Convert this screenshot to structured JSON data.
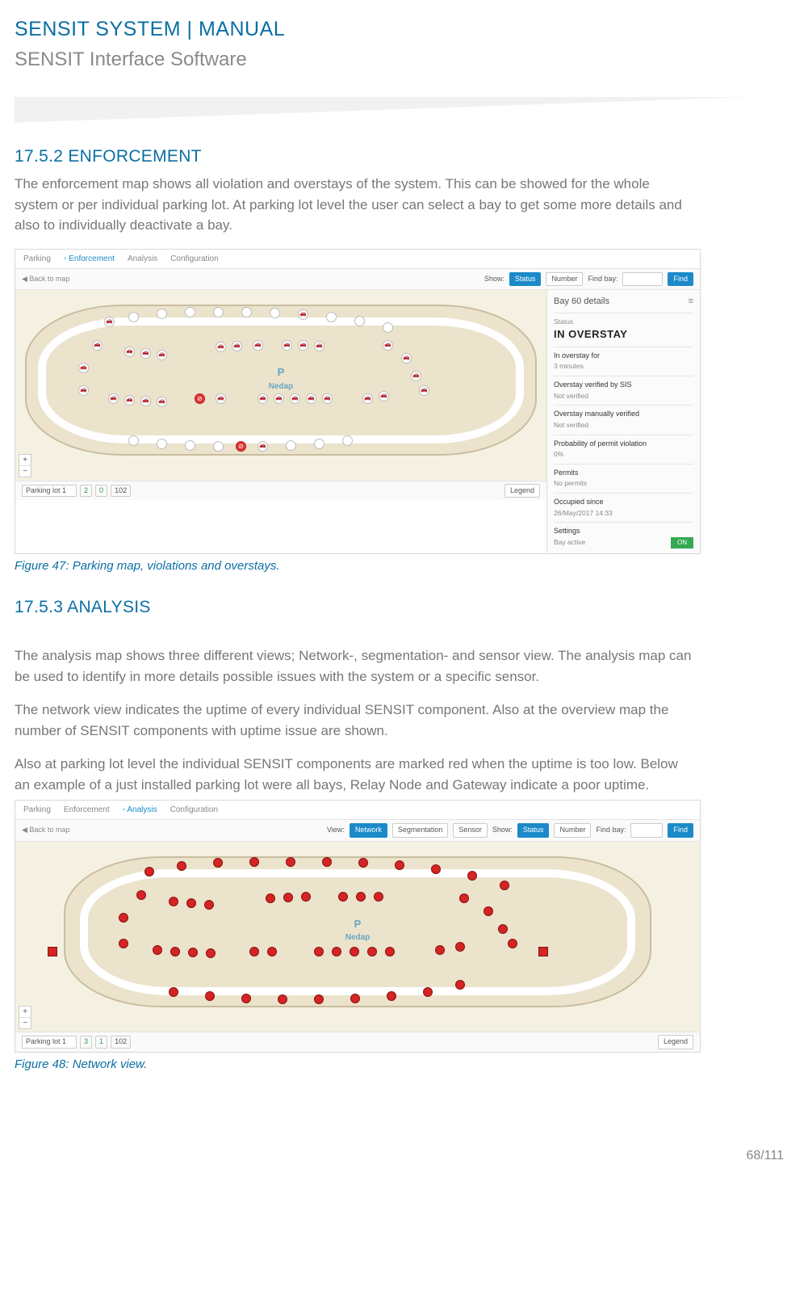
{
  "header": {
    "title": "SENSIT SYSTEM | MANUAL",
    "subtitle": "SENSIT Interface Software"
  },
  "section1": {
    "heading": "17.5.2 ENFORCEMENT",
    "text": "The enforcement map shows all violation and overstays of the system. This can be showed for the whole system or per individual parking lot. At parking lot level the user can select a bay to get some more details and also to individually deactivate a bay."
  },
  "fig1": {
    "caption": "Figure 47: Parking map, violations and overstays.",
    "nav": {
      "parking": "Parking",
      "enforcement": "Enforcement",
      "analysis": "Analysis",
      "configuration": "Configuration"
    },
    "back": "Back to map",
    "toolbar": {
      "show": "Show:",
      "status_btn": "Status",
      "number_btn": "Number",
      "find_label": "Find bay:",
      "find_btn": "Find"
    },
    "brand": {
      "p": "P",
      "name": "Nedap"
    },
    "footer": {
      "lot_label": "Parking lot 1",
      "count_a": "2",
      "count_b": "0",
      "count_c": "102",
      "legend": "Legend"
    },
    "panel": {
      "title": "Bay 60 details",
      "status_label": "Status",
      "status_value": "IN OVERSTAY",
      "overstay_for_label": "In overstay for",
      "overstay_for_value": "3 minutes",
      "verified_sis_label": "Overstay verified by SIS",
      "verified_sis_value": "Not verified",
      "verified_manual_label": "Overstay manually verified",
      "verified_manual_value": "Not verified",
      "prob_label": "Probability of permit violation",
      "prob_value": "0%",
      "permits_label": "Permits",
      "permits_value": "No permits",
      "occupied_label": "Occupied since",
      "occupied_value": "26/May/2017 14:33",
      "settings_label": "Settings",
      "bay_active_label": "Bay active",
      "bay_active_value": "ON"
    }
  },
  "section2": {
    "heading": "17.5.3 ANALYSIS",
    "p1": "The analysis map shows three different views; Network-, segmentation- and sensor view. The analysis map can be used to identify in more details possible issues with the system or a specific sensor.",
    "p2": "The network view indicates the uptime of every individual SENSIT component. Also at the overview map the number of SENSIT components with uptime issue are shown.",
    "p3": "Also at  parking lot level the individual SENSIT components are marked red when the uptime is too low. Below an example of a just installed parking lot were all bays, Relay Node and Gateway indicate a poor uptime."
  },
  "fig2": {
    "caption": "Figure 48: Network view.",
    "nav": {
      "parking": "Parking",
      "enforcement": "Enforcement",
      "analysis": "Analysis",
      "configuration": "Configuration"
    },
    "back": "Back to map",
    "toolbar": {
      "view": "View:",
      "network_btn": "Network",
      "segmentation_btn": "Segmentation",
      "sensor_btn": "Sensor",
      "show": "Show:",
      "status_btn": "Status",
      "number_btn": "Number",
      "find_label": "Find bay:",
      "find_btn": "Find"
    },
    "footer": {
      "lot_label": "Parking lot 1",
      "count_a": "3",
      "count_b": "1",
      "count_c": "102",
      "legend": "Legend"
    }
  },
  "page": "68/111"
}
